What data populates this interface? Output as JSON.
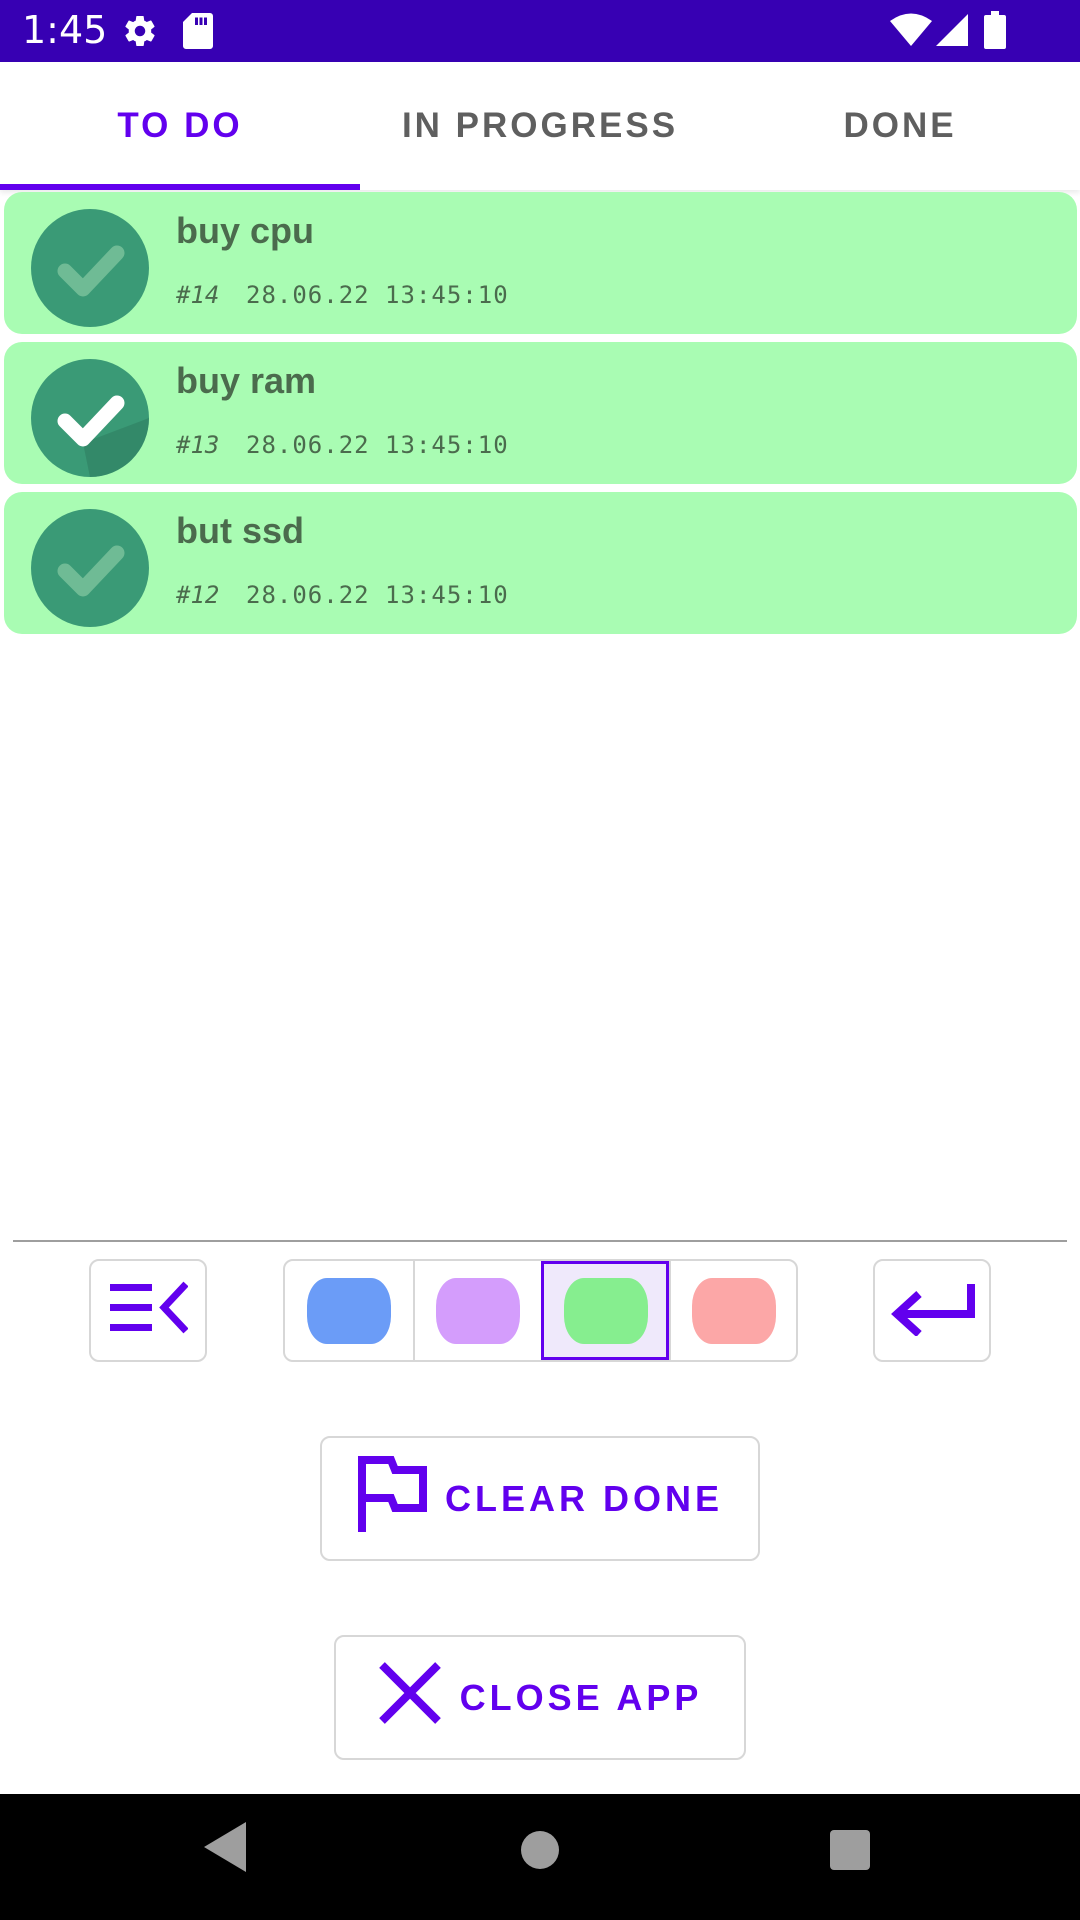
{
  "status_bar": {
    "time": "1:45",
    "background": "#3700b3",
    "left_icons": [
      "settings-gear-icon",
      "sd-card-icon"
    ],
    "right_icons": [
      "wifi-icon",
      "cell-signal-icon",
      "battery-icon"
    ]
  },
  "tabs": [
    {
      "label": "TO DO",
      "active": true
    },
    {
      "label": "IN PROGRESS",
      "active": false
    },
    {
      "label": "DONE",
      "active": false
    }
  ],
  "tasks": [
    {
      "title": "buy cpu",
      "number": "#14",
      "timestamp": "28.06.22 13:45:10",
      "checked": false,
      "color": "#a9fcb3"
    },
    {
      "title": "buy ram",
      "number": "#13",
      "timestamp": "28.06.22 13:45:10",
      "checked": true,
      "color": "#a9fcb3"
    },
    {
      "title": "but ssd",
      "number": "#12",
      "timestamp": "28.06.22 13:45:10",
      "checked": false,
      "color": "#a9fcb3"
    }
  ],
  "toolbar": {
    "left_icon": "collapse-menu-icon",
    "right_icon": "enter-return-icon",
    "colors": [
      {
        "name": "blue",
        "hex": "#6b9cf7",
        "selected": false
      },
      {
        "name": "purple",
        "hex": "#d49dfc",
        "selected": false
      },
      {
        "name": "green",
        "hex": "#86ee8f",
        "selected": true
      },
      {
        "name": "red",
        "hex": "#fca7a7",
        "selected": false
      }
    ]
  },
  "actions": {
    "clear_done": {
      "label": "CLEAR DONE",
      "icon": "flag-icon"
    },
    "close_app": {
      "label": "CLOSE APP",
      "icon": "close-x-icon"
    }
  },
  "theme": {
    "accent": "#6200ee",
    "tab_inactive": "#5f5f5f",
    "task_text": "#4b6b4d"
  }
}
